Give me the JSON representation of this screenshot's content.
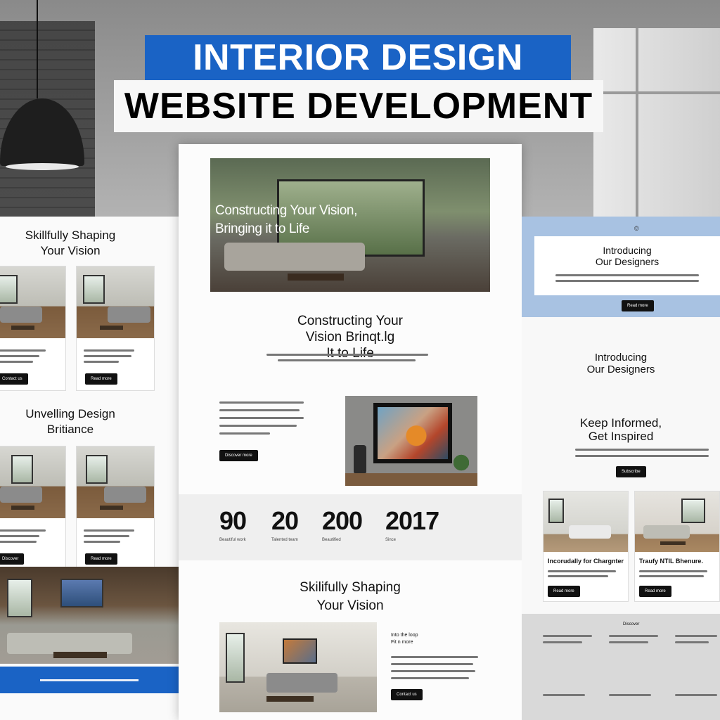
{
  "banner": {
    "line1": "INTERIOR DESIGN",
    "line2": "WEBSITE DEVELOPMENT",
    "accent_color": "#1a63c5"
  },
  "left_page": {
    "heading1_line1": "Skillfully Shaping",
    "heading1_line2": "Your Vision",
    "heading2_line1": "Unvelling Design",
    "heading2_line2": "Britiance",
    "buttons": [
      "Contact us",
      "Read more",
      "Discover",
      "Read more"
    ]
  },
  "center_page": {
    "hero_title_line1": "Constructing Your Vision,",
    "hero_title_line2": "Bringing it to Life",
    "heading_line1": "Constructing Your",
    "heading_line2": "Vision Brinqt.lg",
    "heading_line3": "It to Life",
    "text_button": "Discover more",
    "stats": [
      {
        "value": "90",
        "label": "Beautiful work"
      },
      {
        "value": "20",
        "label": "Talented team"
      },
      {
        "value": "200",
        "label": "Beautified"
      },
      {
        "value": "2017",
        "label": "Since"
      }
    ],
    "section_heading_line1": "Skilifully Shaping",
    "section_heading_line2": "Your Vision",
    "side_title_line1": "Into the loop",
    "side_title_line2": "Fit n more",
    "side_button": "Contact us"
  },
  "right_page": {
    "logo_glyph": "©",
    "card_heading_line1": "Introducing",
    "card_heading_line2": "Our Designers",
    "card_button": "Read more",
    "heading2_line1": "Introducing",
    "heading2_line2": "Our Designers",
    "heading3_line1": "Keep Informed,",
    "heading3_line2": "Get Inspired",
    "heading3_button": "Subscribe",
    "cards": [
      {
        "title": "Incorudally for Chargnter",
        "button": "Read more"
      },
      {
        "title": "Traufy NTIL Bhenure.",
        "button": "Read more"
      }
    ],
    "footer_heading": "Discover"
  }
}
